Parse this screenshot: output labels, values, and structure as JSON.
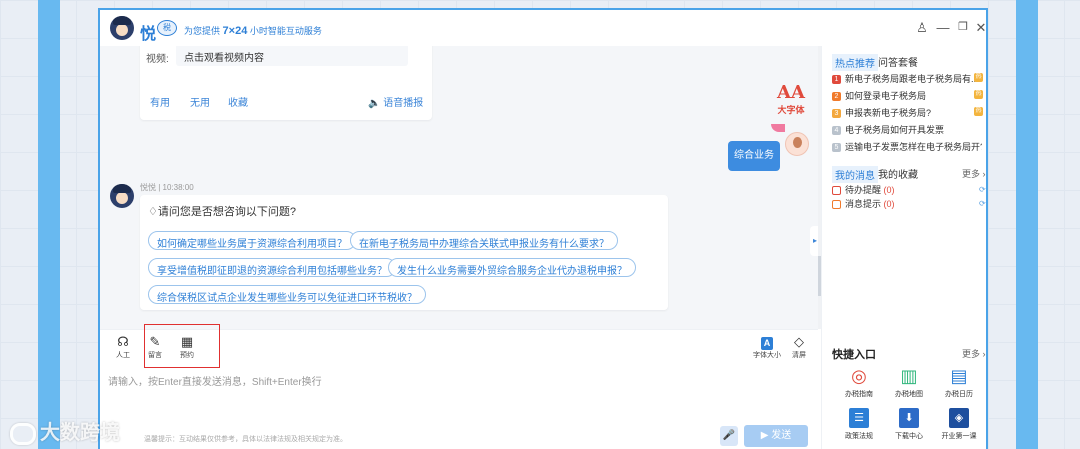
{
  "header": {
    "logo": "悦",
    "logo_badge": "税",
    "slogan_prefix": "为您提供",
    "slogan_highlight": "7×24",
    "slogan_suffix": "小时智能互动服务"
  },
  "window_controls": {
    "user": "♙",
    "minimize": "—",
    "restore": "❐",
    "close": "✕"
  },
  "chat": {
    "video_card": {
      "label": "视频:",
      "content": "点击观看视频内容",
      "useful": "有用",
      "useless": "无用",
      "favorite": "收藏",
      "voice": "🔈 语音播报"
    },
    "big_font_icon": "AA",
    "big_font_label": "大字体",
    "user_message": "综合业务",
    "bot_name_time": "悦悦 | 10:38:00",
    "suggest_title": "请问您是否想咨询以下问题?",
    "suggestions": [
      "如何确定哪些业务属于资源综合利用项目？",
      "在新电子税务局中办理综合关联式申报业务有什么要求？",
      "享受增值税即征即退的资源综合利用包括哪些业务？",
      "发生什么业务需要外贸综合服务企业代办退税申报？",
      "综合保税区试点企业发生哪些业务可以免征进口环节税收？"
    ]
  },
  "toolbar": {
    "human": {
      "icon": "☊",
      "label": "人工"
    },
    "message": {
      "icon": "✎",
      "label": "留言"
    },
    "appointment": {
      "icon": "▦",
      "label": "预约"
    },
    "font_size": {
      "icon": "A",
      "label": "字体大小"
    },
    "clear": {
      "icon": "◇",
      "label": "清屏"
    }
  },
  "input": {
    "placeholder": "请输入，按Enter直接发送消息，Shift+Enter换行",
    "disclaimer": "温馨提示：互动结果仅供参考，具体以法律法规及相关规定为准。",
    "mic_icon": "🎤",
    "send_label": "▶ 发送"
  },
  "right_panel": {
    "tab_hot": "热点推荐",
    "tab_package": "问答套餐",
    "hot_items": [
      {
        "num": "1",
        "text": "新电子税务局跟老电子税务局有...",
        "color": "#e04a3c"
      },
      {
        "num": "2",
        "text": "如何登录电子税务局",
        "color": "#f07a2c"
      },
      {
        "num": "3",
        "text": "申报表新电子税务局?",
        "color": "#f3a73d"
      },
      {
        "num": "4",
        "text": "电子税务局如何开具发票",
        "color": "#b9c2cc"
      },
      {
        "num": "5",
        "text": "运输电子发票怎样在电子税务局开?",
        "color": "#b9c2cc"
      }
    ],
    "hot_badge": "热",
    "tab_msgs": "我的消息",
    "tab_favorites": "我的收藏",
    "more_label": "更多 ›",
    "messages": [
      {
        "label": "待办提醒",
        "count": "(0)"
      },
      {
        "label": "消息提示",
        "count": "(0)"
      }
    ],
    "refresh_icon": "⟳",
    "quick_title": "快捷入口",
    "quick_more": "更多 ›",
    "quick": [
      {
        "icon": "◎",
        "label": "办税指南",
        "color": "#e04a3c"
      },
      {
        "icon": "▥",
        "label": "办税地图",
        "color": "#2fb67c"
      },
      {
        "icon": "▤",
        "label": "办税日历",
        "color": "#2d7fd6"
      },
      {
        "icon": "☰",
        "label": "政策法规",
        "color": "#2d7fd6"
      },
      {
        "icon": "⬇",
        "label": "下载中心",
        "color": "#2d6bc7"
      },
      {
        "icon": "◈",
        "label": "开业第一课",
        "color": "#1e4f9e"
      }
    ]
  },
  "watermark": "大数跨境"
}
